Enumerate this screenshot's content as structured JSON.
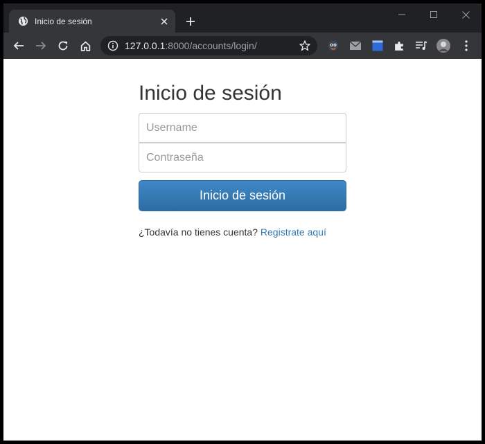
{
  "browser": {
    "tab_title": "Inicio de sesión",
    "url_host": "127.0.0.1",
    "url_rest": ":8000/accounts/login/",
    "icons": [
      "globe-icon",
      "close-icon",
      "plus-icon",
      "minimize-icon",
      "maximize-icon",
      "back-icon",
      "forward-icon",
      "reload-icon",
      "home-icon",
      "info-icon",
      "star-icon",
      "puzzle-icon",
      "media-icon",
      "menu-icon"
    ]
  },
  "login": {
    "title": "Inicio de sesión",
    "username_placeholder": "Username",
    "password_placeholder": "Contraseña",
    "submit_label": "Inicio de sesión",
    "signup_prompt": "¿Todavía no tienes cuenta?",
    "signup_link": "Registrate aquí"
  },
  "colors": {
    "button": "#337ab7",
    "link": "#337ab7",
    "title_text": "#333333"
  }
}
